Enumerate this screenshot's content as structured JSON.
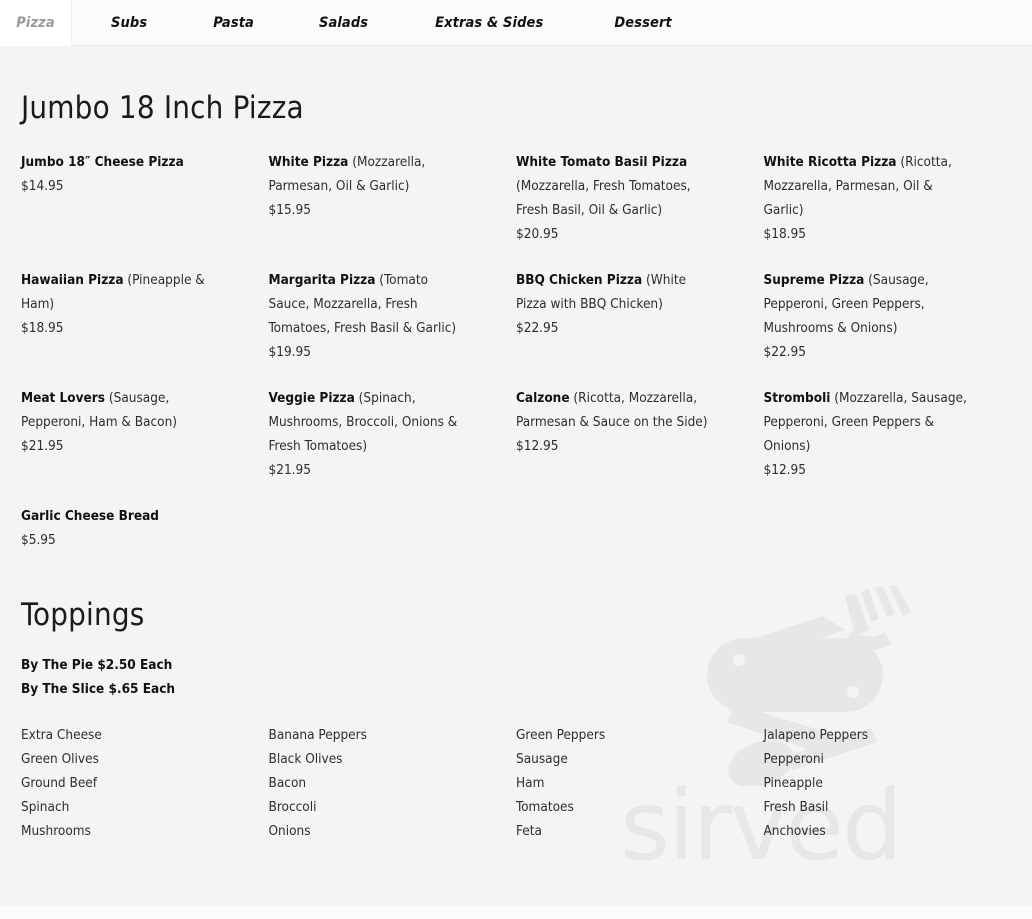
{
  "tabs": [
    {
      "label": "Pizza",
      "active": true
    },
    {
      "label": "Subs",
      "active": false
    },
    {
      "label": "Pasta",
      "active": false
    },
    {
      "label": "Salads",
      "active": false
    },
    {
      "label": "Extras & Sides",
      "active": false
    },
    {
      "label": "Dessert",
      "active": false
    }
  ],
  "watermark": {
    "wordmark": "sirved",
    "logo_icon": "knife-fork-spoon-icon",
    "color": "#e7e7e7"
  },
  "colors": {
    "page_background": "#f4f4f4",
    "tabbar_background": "#fbfbfb",
    "active_tab_background": "#ffffff",
    "active_tab_text": "#9a9a9a",
    "text": "#232323",
    "heading": "#1b1b1b"
  },
  "sections": [
    {
      "title": "Jumbo 18 Inch Pizza",
      "items": [
        {
          "name": "Jumbo 18″ Cheese Pizza",
          "desc": "",
          "price": "$14.95"
        },
        {
          "name": "White Pizza",
          "desc": " (Mozzarella, Parmesan, Oil & Garlic)",
          "price": "$15.95"
        },
        {
          "name": "White Tomato Basil Pizza",
          "desc": " (Mozzarella, Fresh Tomatoes, Fresh Basil, Oil & Garlic)",
          "price": "$20.95"
        },
        {
          "name": "White Ricotta Pizza",
          "desc": " (Ricotta, Mozzarella, Parmesan, Oil & Garlic)",
          "price": "$18.95"
        },
        {
          "name": "Hawaiian Pizza",
          "desc": " (Pineapple & Ham)",
          "price": "$18.95"
        },
        {
          "name": "Margarita Pizza",
          "desc": " (Tomato Sauce, Mozzarella, Fresh Tomatoes, Fresh Basil & Garlic)",
          "price": "$19.95"
        },
        {
          "name": "BBQ Chicken Pizza",
          "desc": " (White Pizza with BBQ Chicken)",
          "price": "$22.95"
        },
        {
          "name": "Supreme Pizza",
          "desc": " (Sausage, Pepperoni, Green Peppers, Mushrooms & Onions)",
          "price": "$22.95"
        },
        {
          "name": "Meat Lovers",
          "desc": " (Sausage, Pepperoni, Ham & Bacon)",
          "price": "$21.95"
        },
        {
          "name": "Veggie Pizza",
          "desc": " (Spinach, Mushrooms, Broccoli, Onions & Fresh Tomatoes)",
          "price": "$21.95"
        },
        {
          "name": "Calzone",
          "desc": " (Ricotta, Mozzarella, Parmesan & Sauce on the Side)",
          "price": "$12.95"
        },
        {
          "name": "Stromboli",
          "desc": " (Mozzarella, Sausage, Pepperoni, Green Peppers & Onions)",
          "price": "$12.95"
        },
        {
          "name": "Garlic Cheese Bread",
          "desc": "",
          "price": "$5.95"
        }
      ]
    }
  ],
  "toppings_section": {
    "title": "Toppings",
    "price_lines": [
      "By The Pie $2.50 Each",
      "By The Slice $.65 Each"
    ],
    "columns": [
      [
        "Extra Cheese",
        "Green Olives",
        "Ground Beef",
        "Spinach",
        "Mushrooms"
      ],
      [
        "Banana Peppers",
        "Black Olives",
        "Bacon",
        "Broccoli",
        "Onions"
      ],
      [
        "Green Peppers",
        "Sausage",
        "Ham",
        "Tomatoes",
        "Feta"
      ],
      [
        "Jalapeno Peppers",
        "Pepperoni",
        "Pineapple",
        "Fresh Basil",
        "Anchovies"
      ]
    ]
  }
}
